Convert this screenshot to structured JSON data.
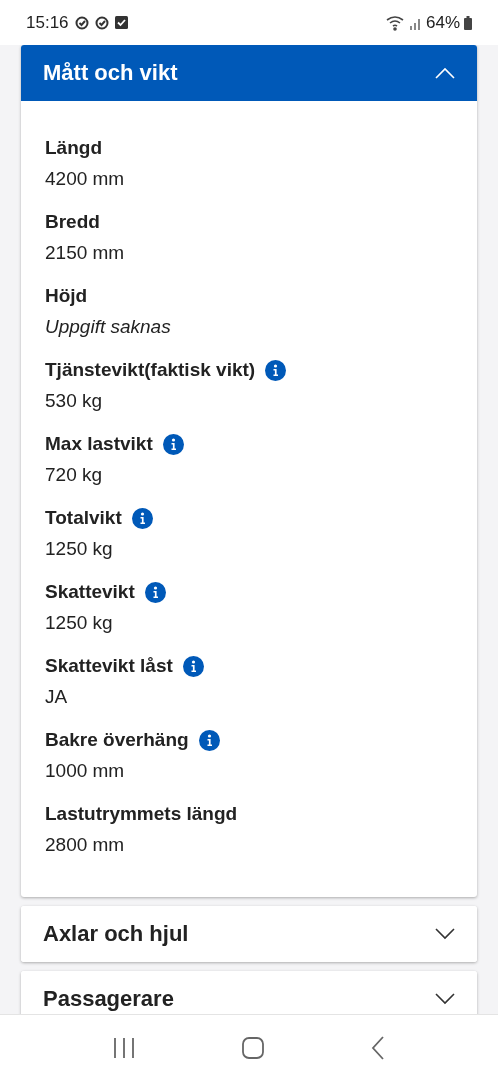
{
  "status_bar": {
    "time": "15:16",
    "battery": "64%"
  },
  "sections": [
    {
      "title": "Mått och vikt",
      "expanded": true,
      "fields": [
        {
          "label": "Längd",
          "value": "4200 mm",
          "info": false,
          "missing": false
        },
        {
          "label": "Bredd",
          "value": "2150 mm",
          "info": false,
          "missing": false
        },
        {
          "label": "Höjd",
          "value": "Uppgift saknas",
          "info": false,
          "missing": true
        },
        {
          "label": "Tjänstevikt(faktisk vikt)",
          "value": "530 kg",
          "info": true,
          "missing": false
        },
        {
          "label": "Max lastvikt",
          "value": "720 kg",
          "info": true,
          "missing": false
        },
        {
          "label": "Totalvikt",
          "value": "1250 kg",
          "info": true,
          "missing": false
        },
        {
          "label": "Skattevikt",
          "value": "1250 kg",
          "info": true,
          "missing": false
        },
        {
          "label": "Skattevikt låst",
          "value": "JA",
          "info": true,
          "missing": false
        },
        {
          "label": "Bakre överhäng",
          "value": "1000 mm",
          "info": true,
          "missing": false
        },
        {
          "label": "Lastutrymmets längd",
          "value": "2800 mm",
          "info": false,
          "missing": false
        }
      ]
    },
    {
      "title": "Axlar och hjul",
      "expanded": false
    },
    {
      "title": "Passagerare",
      "expanded": false
    }
  ]
}
